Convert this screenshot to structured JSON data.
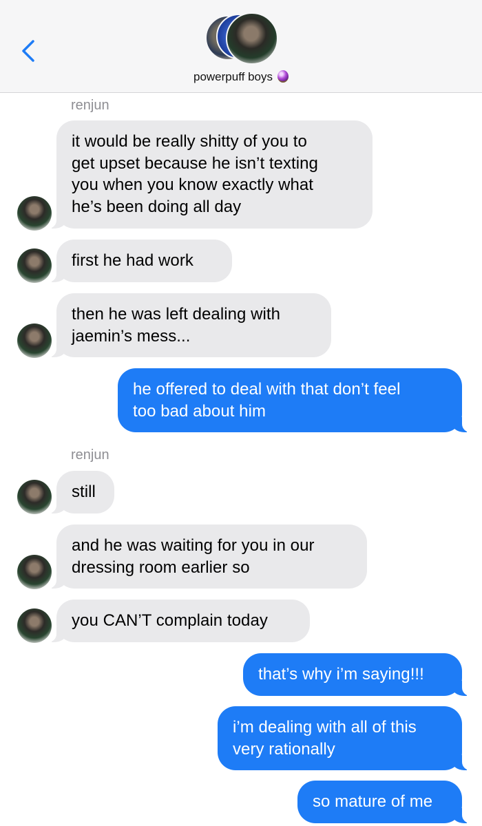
{
  "header": {
    "group_name": "powerpuff boys",
    "back_icon": "chevron-left-icon",
    "group_icon": "crystal-ball-icon"
  },
  "colors": {
    "sent_bubble": "#1e7cf6",
    "received_bubble": "#e9e9eb",
    "accent": "#1e7cf6"
  },
  "messages": [
    {
      "sender": "renjun",
      "direction": "received",
      "text": "it would be really shitty of you to\nget upset because he isn’t texting\nyou when you know exactly what\nhe’s been doing all day"
    },
    {
      "direction": "received",
      "text": "first he had work"
    },
    {
      "direction": "received",
      "text": "then he was left dealing with\njaemin’s mess..."
    },
    {
      "direction": "sent",
      "text": "he offered to deal with that don’t feel\ntoo bad about him"
    },
    {
      "sender": "renjun",
      "direction": "received",
      "text": "still"
    },
    {
      "direction": "received",
      "text": "and he was waiting for you in our\ndressing room earlier so"
    },
    {
      "direction": "received",
      "text": "you CAN’T complain today"
    },
    {
      "direction": "sent",
      "text": "that’s why i’m saying!!!"
    },
    {
      "direction": "sent",
      "text": "i’m dealing with all of this\nvery rationally"
    },
    {
      "direction": "sent",
      "text": "so mature of me"
    }
  ]
}
